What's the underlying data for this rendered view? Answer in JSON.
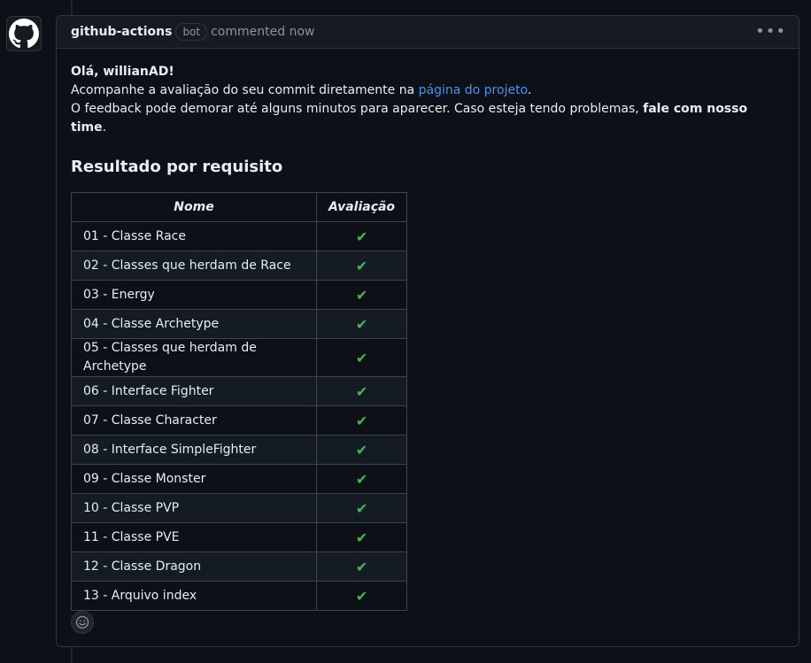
{
  "comment": {
    "author": "github-actions",
    "badge": "bot",
    "time_text": "commented now",
    "menu_icon": "kebab-horizontal-icon",
    "greeting": "Olá, willianAD!",
    "line1_prefix": "Acompanhe a avaliação do seu commit diretamente na ",
    "line1_link": "página do projeto",
    "line1_suffix": ".",
    "line2_prefix": "O feedback pode demorar até alguns minutos para aparecer. Caso esteja tendo problemas, ",
    "line2_bold": "fale com nosso time",
    "line2_suffix": ".",
    "section_title": "Resultado por requisito",
    "table": {
      "headers": [
        "Nome",
        "Avaliação"
      ],
      "rows": [
        {
          "name": "01 - Classe Race",
          "status": "✔"
        },
        {
          "name": "02 - Classes que herdam de Race",
          "status": "✔"
        },
        {
          "name": "03 - Energy",
          "status": "✔"
        },
        {
          "name": "04 - Classe Archetype",
          "status": "✔"
        },
        {
          "name": "05 - Classes que herdam de Archetype",
          "status": "✔"
        },
        {
          "name": "06 - Interface Fighter",
          "status": "✔"
        },
        {
          "name": "07 - Classe Character",
          "status": "✔"
        },
        {
          "name": "08 - Interface SimpleFighter",
          "status": "✔"
        },
        {
          "name": "09 - Classe Monster",
          "status": "✔"
        },
        {
          "name": "10 - Classe PVP",
          "status": "✔"
        },
        {
          "name": "11 - Classe PVE",
          "status": "✔"
        },
        {
          "name": "12 - Classe Dragon",
          "status": "✔"
        },
        {
          "name": "13 - Arquivo index",
          "status": "✔"
        }
      ]
    },
    "reaction_icon": "smiley-icon"
  },
  "colors": {
    "background": "#0d1117",
    "header_bg": "#161b22",
    "border": "#30363d",
    "link": "#4493f8",
    "check": "#3fb950"
  }
}
